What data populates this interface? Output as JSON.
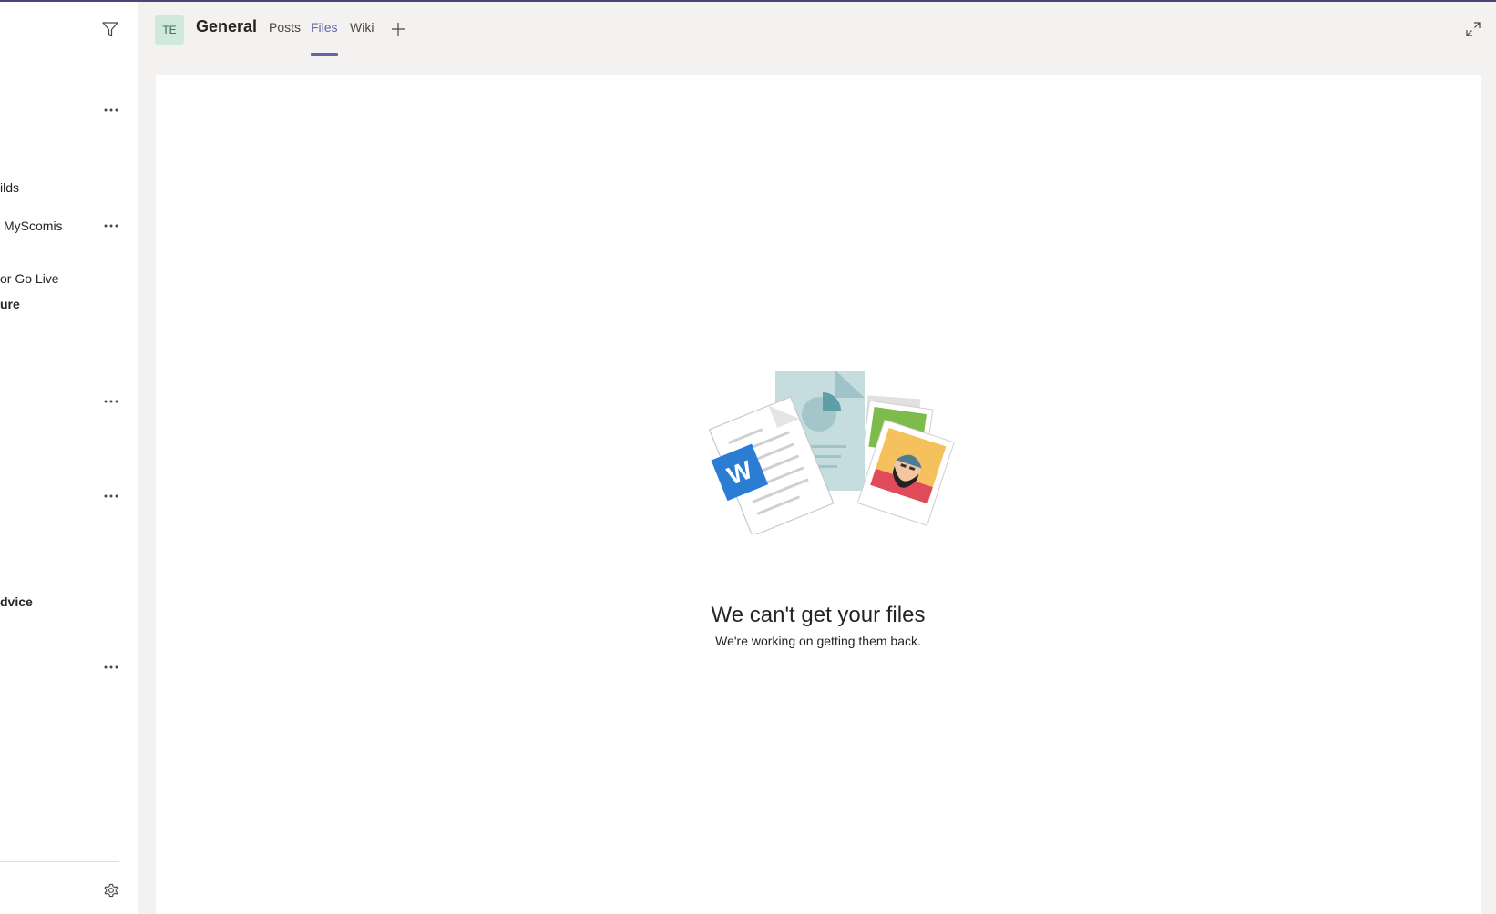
{
  "sidebar": {
    "teams": [
      {
        "label": "ilds",
        "bold": false
      },
      {
        "label": "MyScomis",
        "bold": false
      },
      {
        "label": "or Go Live",
        "bold": false
      },
      {
        "label": "ure",
        "bold": true
      },
      {
        "label": "dvice",
        "bold": true
      }
    ]
  },
  "header": {
    "avatar_initials": "TE",
    "channel_title": "General",
    "tabs": [
      {
        "label": "Posts",
        "active": false
      },
      {
        "label": "Files",
        "active": true
      },
      {
        "label": "Wiki",
        "active": false
      }
    ]
  },
  "empty_state": {
    "title": "We can't get your files",
    "subtitle": "We're working on getting them back."
  },
  "colors": {
    "accent": "#6264a7",
    "top_border": "#464775",
    "avatar_bg": "#cfe9dc",
    "word_blue": "#2b7cd3"
  },
  "icons": [
    "filter-icon",
    "more-options-icon",
    "settings-icon",
    "add-tab-icon",
    "expand-icon",
    "word-icon"
  ]
}
